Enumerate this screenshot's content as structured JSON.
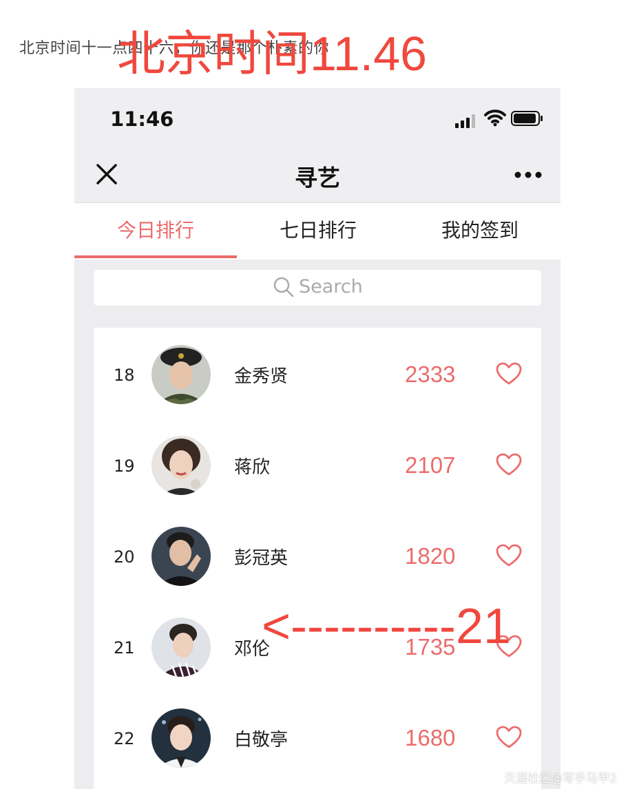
{
  "caption": "北京时间十一点四十六，你还是那个朴素的你",
  "overlay_note": "北京时间11.46",
  "status_bar": {
    "time": "11:46"
  },
  "nav": {
    "title": "寻艺"
  },
  "tabs": [
    {
      "label": "今日排行",
      "active": true
    },
    {
      "label": "七日排行",
      "active": false
    },
    {
      "label": "我的签到",
      "active": false
    }
  ],
  "search": {
    "placeholder": "Search"
  },
  "ranking": [
    {
      "rank": "18",
      "name": "金秀贤",
      "score": "2333"
    },
    {
      "rank": "19",
      "name": "蒋欣",
      "score": "2107"
    },
    {
      "rank": "20",
      "name": "彭冠英",
      "score": "1820"
    },
    {
      "rank": "21",
      "name": "邓伦",
      "score": "1735"
    },
    {
      "rank": "22",
      "name": "白敬亭",
      "score": "1680"
    }
  ],
  "annotation": "<----------21",
  "watermark": "天涯社区@写手马甲2",
  "colors": {
    "accent": "#ec6b6b",
    "annotation": "#f0483e"
  }
}
